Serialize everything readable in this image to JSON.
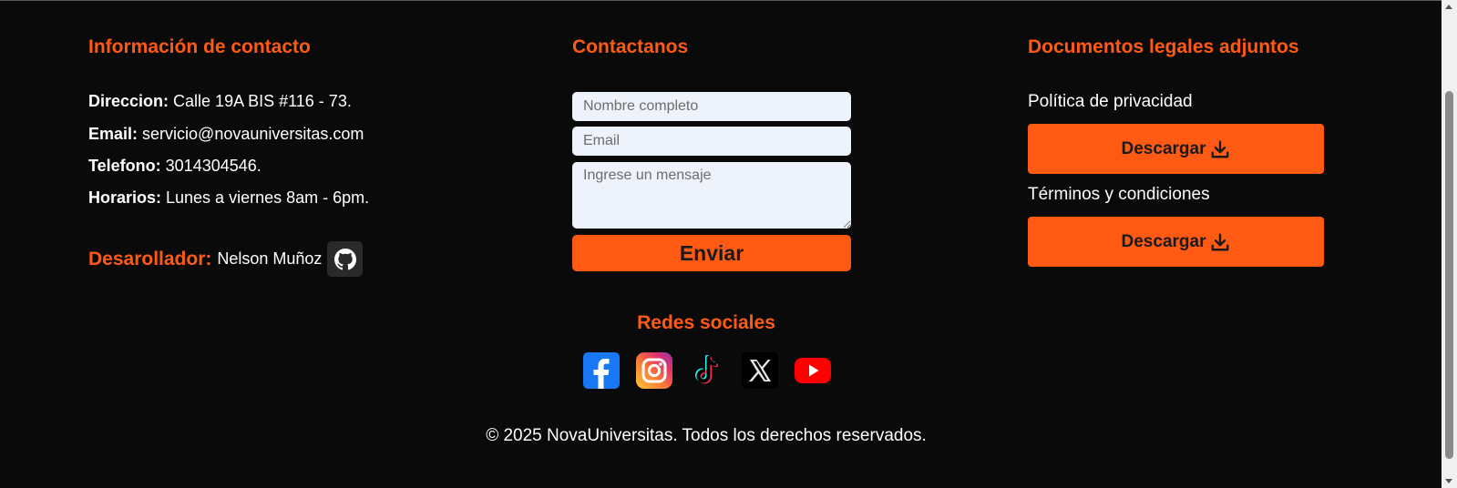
{
  "contact_info": {
    "title": "Información de contacto",
    "lines": [
      {
        "label": "Direccion:",
        "value": " Calle 19A BIS #116 - 73."
      },
      {
        "label": "Email:",
        "value": " servicio@novauniversitas.com"
      },
      {
        "label": "Telefono:",
        "value": " 3014304546."
      },
      {
        "label": "Horarios:",
        "value": " Lunes a viernes 8am - 6pm."
      }
    ],
    "developer_label": "Desarollador:",
    "developer_name": "Nelson Muñoz"
  },
  "contact_form": {
    "title": "Contactanos",
    "name_placeholder": "Nombre completo",
    "email_placeholder": "Email",
    "message_placeholder": "Ingrese un mensaje",
    "submit_label": "Enviar"
  },
  "legal": {
    "title": "Documentos legales adjuntos",
    "docs": [
      {
        "label": "Política de privacidad",
        "button": "Descargar"
      },
      {
        "label": "Términos y condiciones",
        "button": "Descargar"
      }
    ]
  },
  "social": {
    "title": "Redes sociales",
    "icons": [
      "facebook-icon",
      "instagram-icon",
      "tiktok-icon",
      "x-icon",
      "youtube-icon"
    ]
  },
  "copyright": "© 2025 NovaUniversitas. Todos los derechos reservados.",
  "colors": {
    "accent": "#ff5a14",
    "background": "#0a0a0a",
    "input_bg": "#eef3fb"
  }
}
